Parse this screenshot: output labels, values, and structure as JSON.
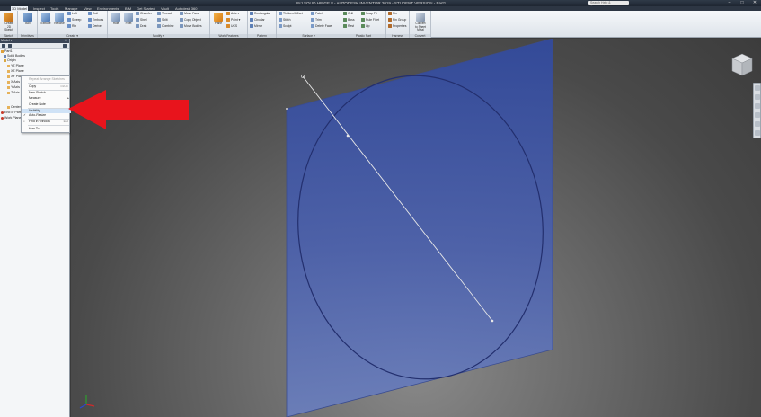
{
  "titlebar": {
    "title": "INJ SOLID HINGE 8 - AUTODESK INVENTOR 2019 - STUDENT VERSION - Part1",
    "search_placeholder": "Search Help & Commands...",
    "min": "–",
    "max": "□",
    "close": "✕"
  },
  "tabs": [
    "3D Model",
    "Inspect",
    "Tools",
    "Manage",
    "View",
    "Environments",
    "BIM",
    "Get Started",
    "Vault",
    "Autodesk 360"
  ],
  "ribbon": {
    "sketch": {
      "create_label": "Create 2D Sketch",
      "group": "Sketch"
    },
    "primitives": {
      "box_label": "Box",
      "group": "Primitives"
    },
    "create": {
      "extrude": "Extrude",
      "revolve": "Revolve",
      "loft": "Loft",
      "sweep": "Sweep",
      "rib": "Rib",
      "coil": "Coil",
      "emboss": "Emboss",
      "derive": "Derive",
      "group": "Create ▾"
    },
    "modify": {
      "hole": "Hole",
      "fillet": "Fillet",
      "chamfer": "Chamfer",
      "shell": "Shell",
      "draft": "Draft",
      "thread": "Thread",
      "split": "Split",
      "combine": "Combine",
      "move_face": "Move Face",
      "copy_object": "Copy Object",
      "move_bodies": "Move Bodies",
      "group": "Modify ▾"
    },
    "work_features": {
      "plane": "Plane",
      "axis": "Axis ▾",
      "point": "Point ▾",
      "ucs": "UCS",
      "group": "Work Features"
    },
    "pattern": {
      "rectangular": "Rectangular",
      "circular": "Circular",
      "mirror": "Mirror",
      "group": "Pattern"
    },
    "surface": {
      "thicken": "Thicken/Offset",
      "stitch": "Stitch",
      "sculpt": "Sculpt",
      "patch": "Patch",
      "trim": "Trim",
      "delete_face": "Delete Face",
      "group": "Surface ▾"
    },
    "plastic": {
      "grill": "Grill",
      "boss": "Boss",
      "rest": "Rest",
      "snap_fit": "Snap Fit",
      "rule_fillet": "Rule Fillet",
      "lip": "Lip",
      "group": "Plastic Part"
    },
    "harness": {
      "pin": "Pin",
      "pin_group": "Pin Group",
      "properties": "Properties",
      "group": "Harness"
    },
    "convert": {
      "sheet_metal": "Convert to Sheet Metal",
      "group": "Convert"
    }
  },
  "browser": {
    "header": "Model ▾",
    "close": "✕",
    "items": [
      "Part1",
      "Solid Bodies",
      "Origin",
      "YZ Plane",
      "XZ Plane",
      "XY Plane",
      "X Axis",
      "Y Axis",
      "Z Axis",
      "Center",
      "End of Part",
      "Work Plane"
    ]
  },
  "context_menu": {
    "items": [
      {
        "label": "Repeat Arrange Sketches",
        "shortcut": "",
        "state": "disabled"
      },
      {
        "label": "Copy",
        "shortcut": "Ctrl+C",
        "state": "normal"
      },
      {
        "label": "New Sketch",
        "shortcut": "",
        "state": "normal"
      },
      {
        "label": "Measure",
        "shortcut": "",
        "state": "submenu"
      },
      {
        "label": "Create Note",
        "shortcut": "",
        "state": "normal"
      },
      {
        "label": "Visibility",
        "shortcut": "",
        "state": "highlight"
      },
      {
        "label": "Auto-Resize",
        "shortcut": "",
        "state": "checked"
      },
      {
        "label": "Find in Window",
        "shortcut": "End",
        "state": "normal"
      },
      {
        "label": "How To...",
        "shortcut": "",
        "state": "normal"
      }
    ]
  },
  "colors": {
    "plane_fill": "#4a5fae",
    "plane_edge": "#3a4c8f",
    "arrow": "#e8141c",
    "circle": "#232f6e",
    "line": "#e8e8e8"
  },
  "icons": [
    "viewcube-icon",
    "navbar-icon",
    "triad-icon",
    "red-arrow"
  ]
}
